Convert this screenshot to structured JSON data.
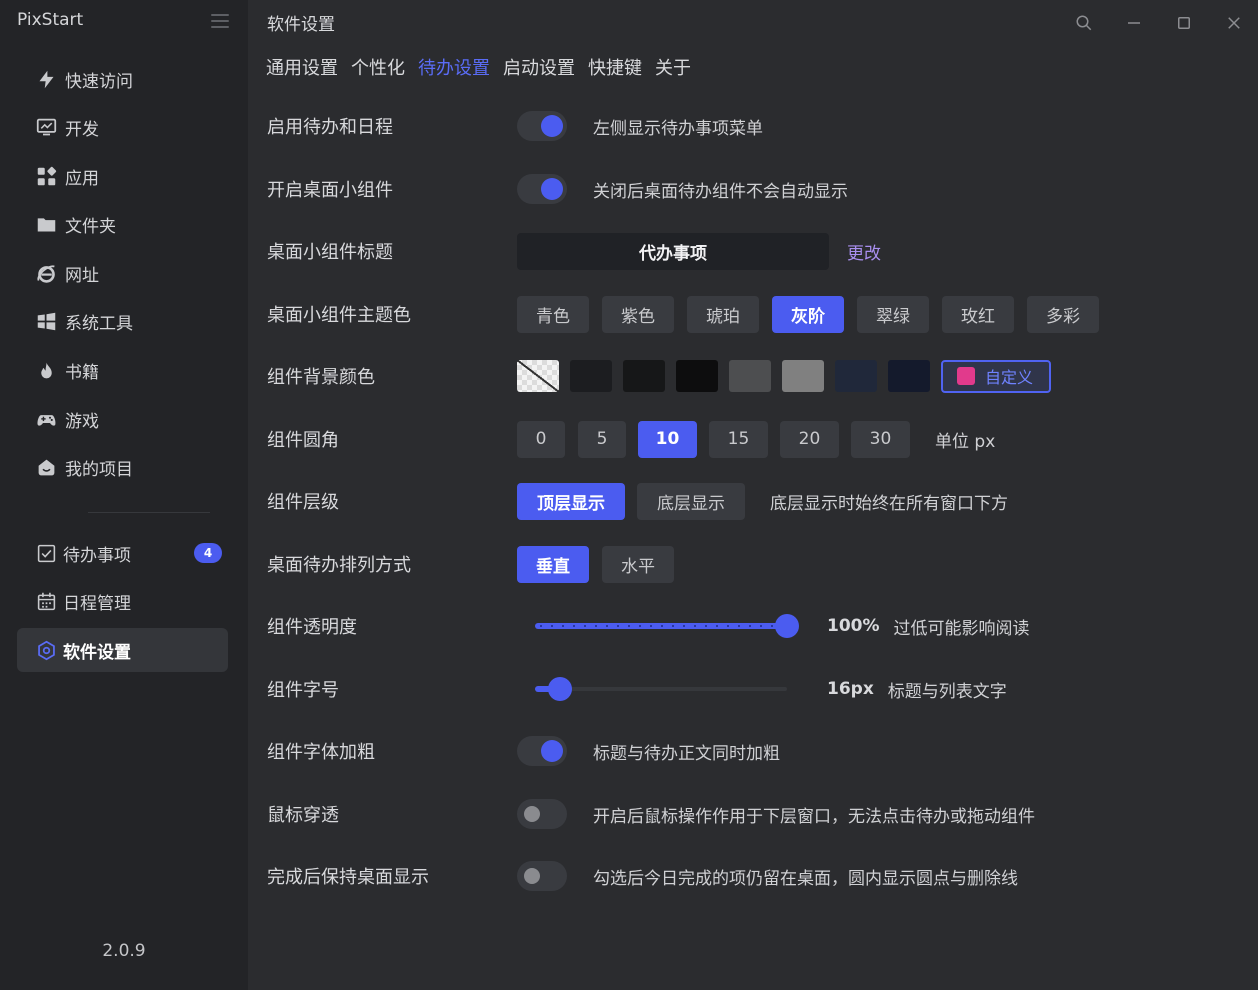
{
  "app": {
    "title": "PixStart",
    "version": "2.0.9"
  },
  "sidebar": {
    "items": [
      {
        "label": "快速访问",
        "icon": "bolt-icon"
      },
      {
        "label": "开发",
        "icon": "monitor-icon"
      },
      {
        "label": "应用",
        "icon": "apps-grid-icon"
      },
      {
        "label": "文件夹",
        "icon": "folder-icon"
      },
      {
        "label": "网址",
        "icon": "ie-browser-icon"
      },
      {
        "label": "系统工具",
        "icon": "windows-icon"
      },
      {
        "label": "书籍",
        "icon": "flame-icon"
      },
      {
        "label": "游戏",
        "icon": "gamepad-icon"
      },
      {
        "label": "我的项目",
        "icon": "project-icon"
      }
    ],
    "bottom_items": [
      {
        "label": "待办事项",
        "icon": "checkbox-icon",
        "badge": "4"
      },
      {
        "label": "日程管理",
        "icon": "calendar-icon"
      },
      {
        "label": "软件设置",
        "icon": "settings-hex-icon",
        "active": true
      }
    ]
  },
  "header": {
    "title": "软件设置"
  },
  "tabs": [
    {
      "label": "通用设置"
    },
    {
      "label": "个性化"
    },
    {
      "label": "待办设置",
      "active": true
    },
    {
      "label": "启动设置"
    },
    {
      "label": "快捷键"
    },
    {
      "label": "关于"
    }
  ],
  "settings": {
    "enable_todo": {
      "label": "启用待办和日程",
      "on": true,
      "desc": "左侧显示待办事项菜单"
    },
    "desktop_widget": {
      "label": "开启桌面小组件",
      "on": true,
      "desc": "关闭后桌面待办组件不会自动显示"
    },
    "widget_title": {
      "label": "桌面小组件标题",
      "value": "代办事项",
      "change_label": "更改"
    },
    "theme_color": {
      "label": "桌面小组件主题色",
      "options": [
        "青色",
        "紫色",
        "琥珀",
        "灰阶",
        "翠绿",
        "玫红",
        "多彩"
      ],
      "selected": "灰阶"
    },
    "bg_color": {
      "label": "组件背景颜色",
      "swatches": [
        "transparent",
        "#1c1d20",
        "#161718",
        "#0d0d0e",
        "#4d4e50",
        "#808080",
        "#20283a",
        "#141a2c"
      ],
      "custom_label": "自定义",
      "custom_color": "#e13a8c"
    },
    "radius": {
      "label": "组件圆角",
      "options": [
        "0",
        "5",
        "10",
        "15",
        "20",
        "30"
      ],
      "selected": "10",
      "unit": "单位 px"
    },
    "layer": {
      "label": "组件层级",
      "options": [
        "顶层显示",
        "底层显示"
      ],
      "selected": "顶层显示",
      "desc": "底层显示时始终在所有窗口下方"
    },
    "arrange": {
      "label": "桌面待办排列方式",
      "options": [
        "垂直",
        "水平"
      ],
      "selected": "垂直"
    },
    "opacity": {
      "label": "组件透明度",
      "value": 100,
      "min": 0,
      "max": 100,
      "value_text": "100%",
      "desc": "过低可能影响阅读"
    },
    "font_size": {
      "label": "组件字号",
      "value": 0.1,
      "value_text": "16px",
      "desc": "标题与列表文字"
    },
    "bold": {
      "label": "组件字体加粗",
      "on": true,
      "desc": "标题与待办正文同时加粗"
    },
    "click_through": {
      "label": "鼠标穿透",
      "on": false,
      "desc": "开启后鼠标操作作用于下层窗口，无法点击待办或拖动组件"
    },
    "keep_done": {
      "label": "完成后保持桌面显示",
      "on": false,
      "desc": "勾选后今日完成的项仍留在桌面，圆内显示圆点与删除线"
    }
  },
  "colors": {
    "accent": "#4b5cf0",
    "link": "#a98ff0",
    "sidebar_bg": "#232427",
    "main_bg": "#2b2c2f"
  }
}
